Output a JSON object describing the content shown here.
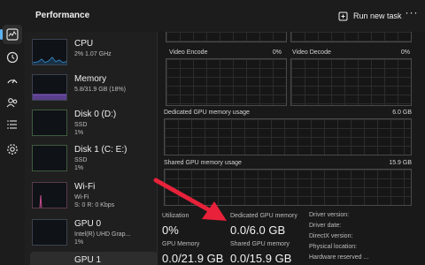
{
  "header": {
    "title": "Performance",
    "run_new_task": "Run new task",
    "more": "···"
  },
  "rail": {
    "icons": [
      "performance-icon",
      "history-icon",
      "startup-icon",
      "users-icon",
      "details-icon",
      "services-icon"
    ]
  },
  "resources": [
    {
      "name": "CPU",
      "sub1": "2% 1.07 GHz",
      "sub2": "",
      "color": "#3aa0e8"
    },
    {
      "name": "Memory",
      "sub1": "5.8/31.9 GB (18%)",
      "sub2": "",
      "color": "#8a5fd1"
    },
    {
      "name": "Disk 0 (D:)",
      "sub1": "SSD",
      "sub2": "1%",
      "color": "#4fae4f"
    },
    {
      "name": "Disk 1 (C: E:)",
      "sub1": "SSD",
      "sub2": "1%",
      "color": "#4fae4f"
    },
    {
      "name": "Wi-Fi",
      "sub1": "Wi-Fi",
      "sub2": "S: 0 R: 0 Kbps",
      "color": "#c94b8f"
    },
    {
      "name": "GPU 0",
      "sub1": "Intel(R) UHD Grap...",
      "sub2": "1%",
      "color": "#3aa0e8"
    },
    {
      "name": "GPU 1",
      "sub1": "",
      "sub2": "",
      "color": "#3aa0e8"
    }
  ],
  "engines": {
    "video_encode": "Video Encode",
    "video_encode_pct": "0%",
    "video_decode": "Video Decode",
    "video_decode_pct": "0%"
  },
  "dedicated_graph": {
    "label": "Dedicated GPU memory usage",
    "max": "6.0 GB"
  },
  "shared_graph": {
    "label": "Shared GPU memory usage",
    "max": "15.9 GB"
  },
  "stats": {
    "utilization_label": "Utilization",
    "utilization_value": "0%",
    "dedicated_label": "Dedicated GPU memory",
    "dedicated_value": "0.0/6.0 GB",
    "gpu_memory_label": "GPU Memory",
    "gpu_memory_value": "0.0/21.9 GB",
    "shared_label": "Shared GPU memory",
    "shared_value": "0.0/15.9 GB"
  },
  "details": [
    "Driver version:",
    "Driver date:",
    "DirectX version:",
    "Physical location:",
    "Hardware reserved ..."
  ],
  "colors": {
    "accent": "#5fb2f2",
    "arrow": "#e8223a"
  }
}
